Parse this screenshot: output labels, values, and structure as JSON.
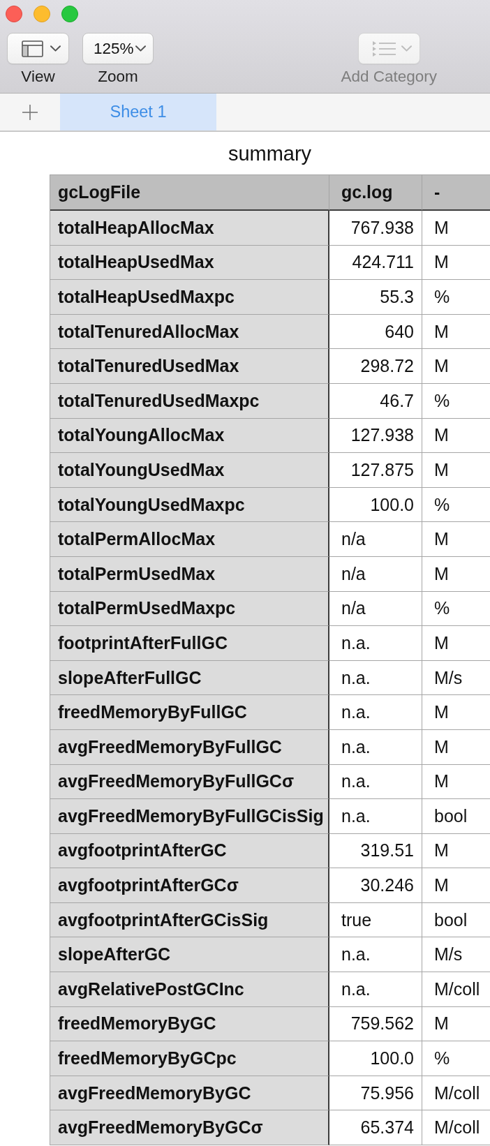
{
  "toolbar": {
    "items": [
      {
        "kind": "layout",
        "label": "View",
        "disabled": false
      },
      {
        "kind": "zoom",
        "value": "125%",
        "label": "Zoom",
        "disabled": false
      },
      {
        "kind": "list",
        "label": "Add Category",
        "disabled": true
      }
    ]
  },
  "sheet_tabs": {
    "tabs": [
      {
        "label": "Sheet 1",
        "selected": true
      }
    ]
  },
  "table": {
    "title": "summary",
    "columns": [
      "gcLogFile",
      "gc.log",
      "-"
    ],
    "rows": [
      {
        "name": "totalHeapAllocMax",
        "value": "767.938",
        "unit": "M",
        "kind": "number"
      },
      {
        "name": "totalHeapUsedMax",
        "value": "424.711",
        "unit": "M",
        "kind": "number"
      },
      {
        "name": "totalHeapUsedMaxpc",
        "value": "55.3",
        "unit": "%",
        "kind": "number"
      },
      {
        "name": "totalTenuredAllocMax",
        "value": "640",
        "unit": "M",
        "kind": "number"
      },
      {
        "name": "totalTenuredUsedMax",
        "value": "298.72",
        "unit": "M",
        "kind": "number"
      },
      {
        "name": "totalTenuredUsedMaxpc",
        "value": "46.7",
        "unit": "%",
        "kind": "number"
      },
      {
        "name": "totalYoungAllocMax",
        "value": "127.938",
        "unit": "M",
        "kind": "number"
      },
      {
        "name": "totalYoungUsedMax",
        "value": "127.875",
        "unit": "M",
        "kind": "number"
      },
      {
        "name": "totalYoungUsedMaxpc",
        "value": "100.0",
        "unit": "%",
        "kind": "number"
      },
      {
        "name": "totalPermAllocMax",
        "value": "n/a",
        "unit": "M",
        "kind": "text"
      },
      {
        "name": "totalPermUsedMax",
        "value": "n/a",
        "unit": "M",
        "kind": "text"
      },
      {
        "name": "totalPermUsedMaxpc",
        "value": "n/a",
        "unit": "%",
        "kind": "text"
      },
      {
        "name": "footprintAfterFullGC",
        "value": "n.a.",
        "unit": "M",
        "kind": "text"
      },
      {
        "name": "slopeAfterFullGC",
        "value": "n.a.",
        "unit": "M/s",
        "kind": "text"
      },
      {
        "name": "freedMemoryByFullGC",
        "value": "n.a.",
        "unit": "M",
        "kind": "text"
      },
      {
        "name": "avgFreedMemoryByFullGC",
        "value": "n.a.",
        "unit": "M",
        "kind": "text"
      },
      {
        "name": "avgFreedMemoryByFullGCσ",
        "value": "n.a.",
        "unit": "M",
        "kind": "text"
      },
      {
        "name": "avgFreedMemoryByFullGCisSig",
        "value": "n.a.",
        "unit": "bool",
        "kind": "text"
      },
      {
        "name": "avgfootprintAfterGC",
        "value": "319.51",
        "unit": "M",
        "kind": "number"
      },
      {
        "name": "avgfootprintAfterGCσ",
        "value": "30.246",
        "unit": "M",
        "kind": "number"
      },
      {
        "name": "avgfootprintAfterGCisSig",
        "value": "true",
        "unit": "bool",
        "kind": "text"
      },
      {
        "name": "slopeAfterGC",
        "value": "n.a.",
        "unit": "M/s",
        "kind": "text"
      },
      {
        "name": "avgRelativePostGCInc",
        "value": "n.a.",
        "unit": "M/coll",
        "kind": "text"
      },
      {
        "name": "freedMemoryByGC",
        "value": "759.562",
        "unit": "M",
        "kind": "number"
      },
      {
        "name": "freedMemoryByGCpc",
        "value": "100.0",
        "unit": "%",
        "kind": "number"
      },
      {
        "name": "avgFreedMemoryByGC",
        "value": "75.956",
        "unit": "M/coll",
        "kind": "number"
      },
      {
        "name": "avgFreedMemoryByGCσ",
        "value": "65.374",
        "unit": "M/coll",
        "kind": "number"
      }
    ]
  }
}
